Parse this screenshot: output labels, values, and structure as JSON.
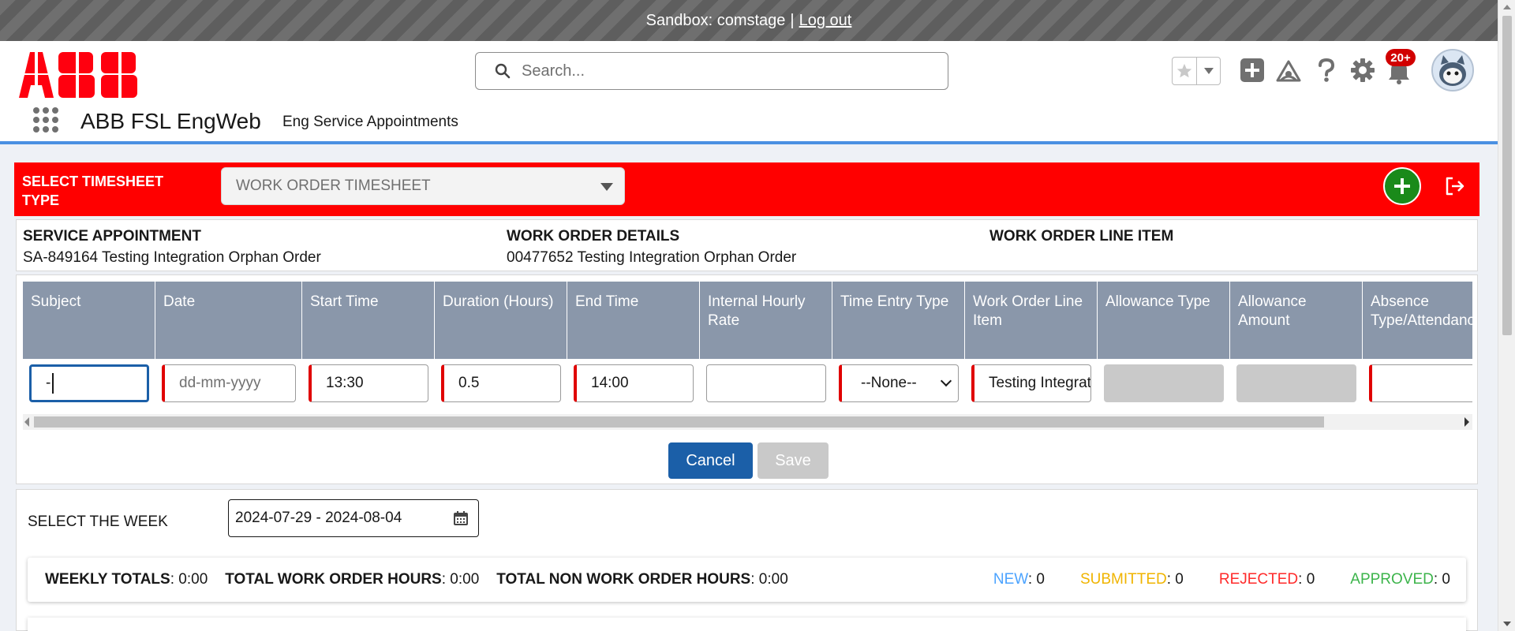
{
  "sandbox": {
    "label": "Sandbox: comstage",
    "separator": "|",
    "logout": "Log out"
  },
  "header": {
    "search_placeholder": "Search...",
    "notification_count": "20+",
    "app_name": "ABB FSL EngWeb",
    "nav_tab": "Eng Service Appointments",
    "icons": [
      "star-icon",
      "chevron-down-icon",
      "add-icon",
      "trailhead-icon",
      "help-icon",
      "gear-icon",
      "bell-icon",
      "avatar"
    ]
  },
  "timesheet": {
    "type_label": "SELECT TIMESHEET TYPE",
    "type_value": "WORK ORDER TIMESHEET",
    "info": {
      "service_appointment": {
        "heading": "SERVICE APPOINTMENT",
        "value": "SA-849164 Testing Integration Orphan Order"
      },
      "work_order_details": {
        "heading": "WORK ORDER DETAILS",
        "value": "00477652 Testing Integration Orphan Order"
      },
      "work_order_line_item": {
        "heading": "WORK ORDER LINE ITEM",
        "value": ""
      }
    },
    "columns": [
      "Subject",
      "Date",
      "Start Time",
      "Duration (Hours)",
      "End Time",
      "Internal Hourly Rate",
      "Time Entry Type",
      "Work Order Line Item",
      "Allowance Type",
      "Allowance Amount",
      "Absence Type/Attendance Type"
    ],
    "row": {
      "subject": "-",
      "date_placeholder": "dd-mm-yyyy",
      "start_time": "13:30",
      "duration": "0.5",
      "end_time": "14:00",
      "internal_hourly_rate": "",
      "time_entry_type": "--None--",
      "work_order_line_item": "Testing Integration Orphan Order",
      "allowance_type": "",
      "allowance_amount": "",
      "absence_type": ""
    },
    "buttons": {
      "cancel": "Cancel",
      "save": "Save"
    }
  },
  "week": {
    "label": "SELECT THE WEEK",
    "range": "2024-07-29 - 2024-08-04"
  },
  "totals": {
    "weekly_label": "WEEKLY TOTALS",
    "weekly_value": ": 0:00",
    "work_order_label": "TOTAL WORK ORDER HOURS",
    "work_order_value": ": 0:00",
    "non_work_order_label": "TOTAL NON WORK ORDER HOURS",
    "non_work_order_value": ": 0:00",
    "statuses": [
      {
        "label": "NEW",
        "value": ": 0",
        "color": "#4ba3ff"
      },
      {
        "label": "SUBMITTED",
        "value": ": 0",
        "color": "#f0b400"
      },
      {
        "label": "REJECTED",
        "value": ": 0",
        "color": "#ff2a2a"
      },
      {
        "label": "APPROVED",
        "value": ": 0",
        "color": "#3cb44b"
      }
    ]
  },
  "colors": {
    "brand_red": "#ff0000",
    "header_accent": "#4a90e2",
    "table_header": "#8a97aa",
    "primary_button": "#1b5fa8",
    "add_green": "#1a8a1a"
  }
}
